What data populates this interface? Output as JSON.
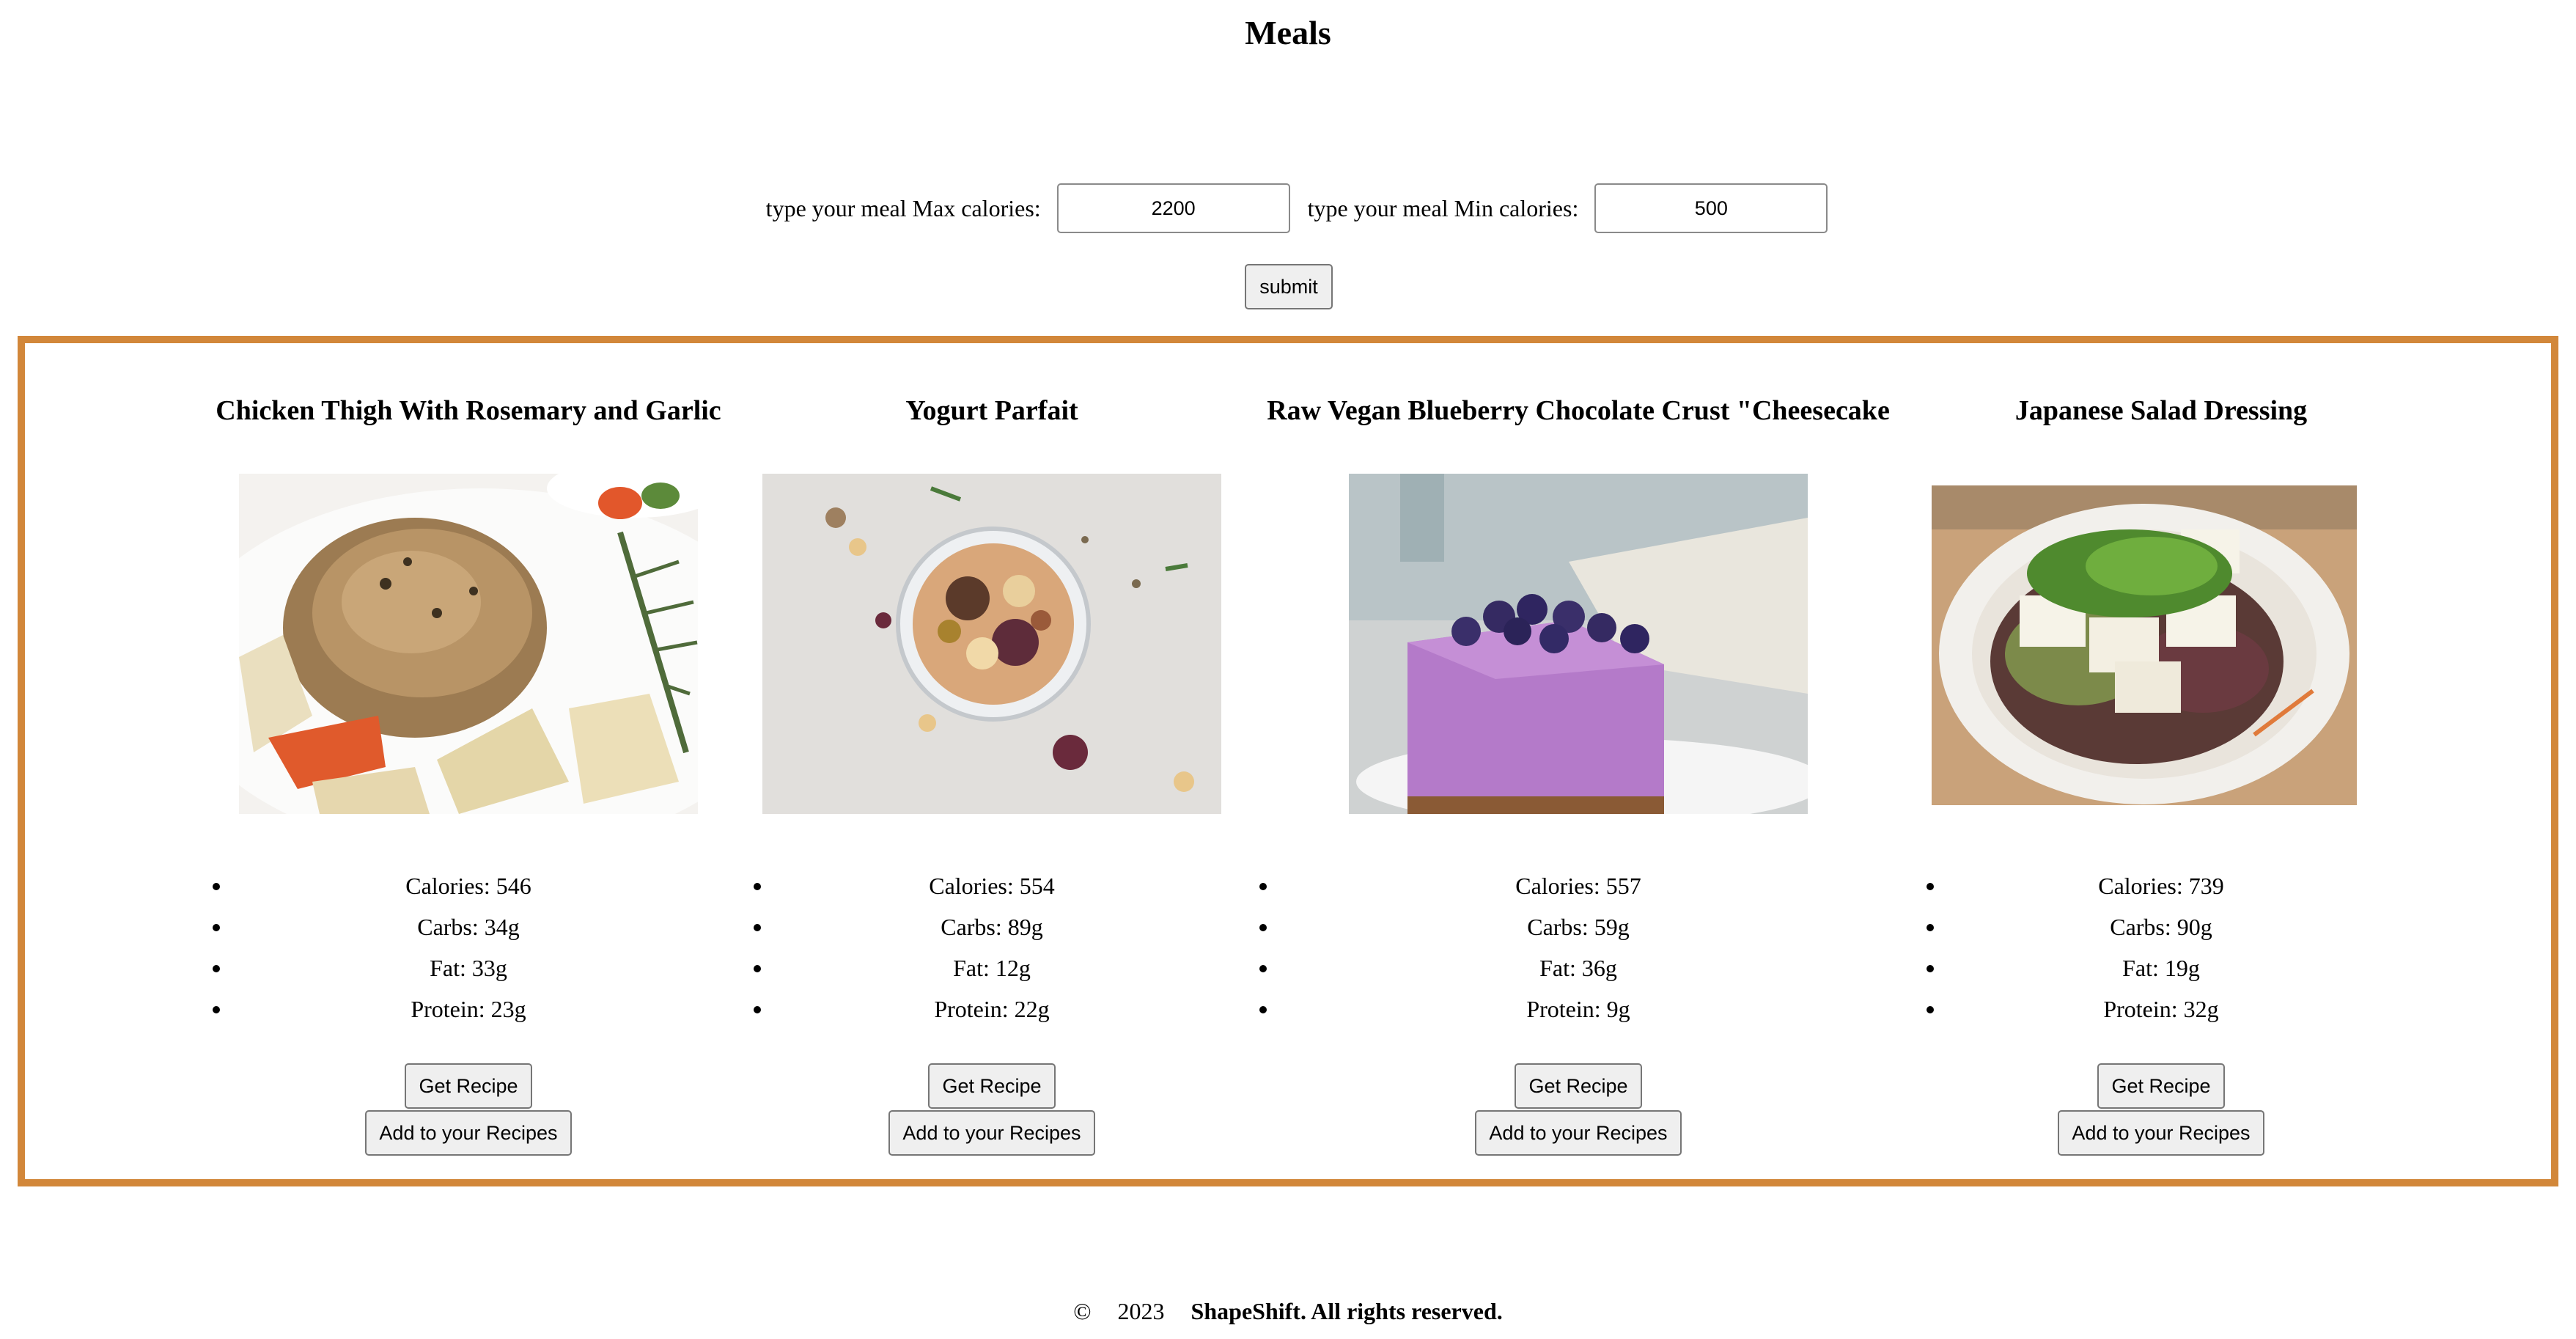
{
  "page": {
    "title": "Meals"
  },
  "filters": {
    "max_label": "type your meal Max calories:",
    "max_value": "2200",
    "min_label": "type your meal Min calories:",
    "min_value": "500",
    "submit_label": "submit"
  },
  "colors": {
    "frame_border": "#d2873a"
  },
  "meals": [
    {
      "name": "Chicken Thigh With Rosemary and Garlic",
      "image": "chicken-thigh-photo",
      "calories": "Calories: 546",
      "carbs": "Carbs: 34g",
      "fat": "Fat: 33g",
      "protein": "Protein: 23g",
      "get_recipe": "Get Recipe",
      "add_recipe": "Add to your Recipes"
    },
    {
      "name": "Yogurt Parfait",
      "image": "yogurt-parfait-photo",
      "calories": "Calories: 554",
      "carbs": "Carbs: 89g",
      "fat": "Fat: 12g",
      "protein": "Protein: 22g",
      "get_recipe": "Get Recipe",
      "add_recipe": "Add to your Recipes"
    },
    {
      "name": "Raw Vegan Blueberry Chocolate Crust \"Cheesecake",
      "image": "blueberry-cheesecake-photo",
      "calories": "Calories: 557",
      "carbs": "Carbs: 59g",
      "fat": "Fat: 36g",
      "protein": "Protein: 9g",
      "get_recipe": "Get Recipe",
      "add_recipe": "Add to your Recipes"
    },
    {
      "name": "Japanese Salad Dressing",
      "image": "tofu-salad-photo",
      "calories": "Calories: 739",
      "carbs": "Carbs: 90g",
      "fat": "Fat: 19g",
      "protein": "Protein: 32g",
      "get_recipe": "Get Recipe",
      "add_recipe": "Add to your Recipes"
    }
  ],
  "footer": {
    "copyright_symbol": "©",
    "year": "2023",
    "rights": "ShapeShift. All rights reserved."
  }
}
